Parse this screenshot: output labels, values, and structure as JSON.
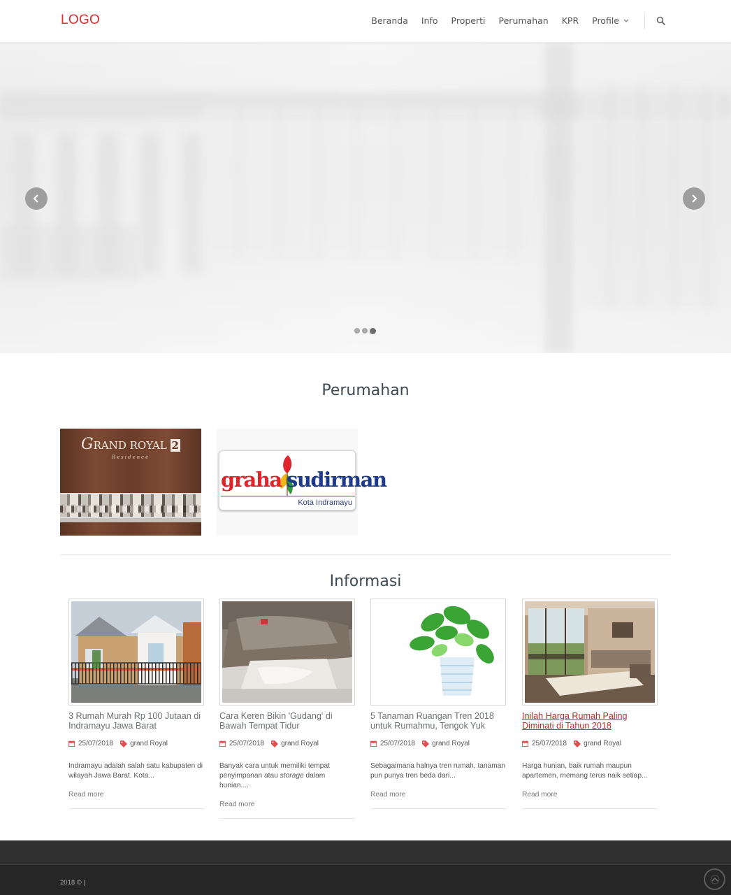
{
  "header": {
    "logo": "LOGO",
    "nav": [
      "Beranda",
      "Info",
      "Properti",
      "Perumahan",
      "KPR",
      "Profile"
    ]
  },
  "hero": {
    "slides": 3,
    "active_slide": 3
  },
  "perumahan": {
    "title": "Perumahan",
    "estates": [
      {
        "name_part1": "RAND ROYAL",
        "name_initial": "G",
        "name_number": "2",
        "subtitle": "Residence"
      },
      {
        "name_part1": "graha",
        "name_part2": "sudirman",
        "subtitle": "Kota Indramayu"
      }
    ]
  },
  "informasi": {
    "title": "Informasi",
    "articles": [
      {
        "title": "3 Rumah Murah Rp 100 Jutaan di Indramayu Jawa Barat",
        "date": "25/07/2018",
        "tag": "grand Royal",
        "excerpt": "Indramayu adalah salah satu kabupaten di wilayah Jawa Barat. Kota...",
        "read_more": "Read more"
      },
      {
        "title": "Cara Keren Bikin 'Gudang' di Bawah Tempat Tidur",
        "date": "25/07/2018",
        "tag": "grand Royal",
        "excerpt_pre": "Banyak cara untuk memiliki tempat penyimpanan atau ",
        "excerpt_em": "storage",
        "excerpt_post": " dalam hunian....",
        "read_more": "Read more"
      },
      {
        "title": "5 Tanaman Ruangan Tren 2018 untuk Rumahmu, Tengok Yuk",
        "date": "25/07/2018",
        "tag": "grand Royal",
        "excerpt": "Sebagaimana halnya tren rumah, tanaman pun punya tren beda dari...",
        "read_more": "Read more"
      },
      {
        "title": "Inilah Harga Rumah Paling Diminati di Tahun 2018",
        "date": "25/07/2018",
        "tag": "grand Royal",
        "excerpt": "Harga hunian, baik rumah maupun apartemen, memang terus naik setiap...",
        "read_more": "Read more"
      }
    ]
  },
  "footer": {
    "copyright": "2018 © |"
  },
  "colors": {
    "accent": "#d32f2f",
    "footer_dark": "#262626",
    "footer_mid": "#303030"
  },
  "icons": [
    "search-icon",
    "chevron-left-icon",
    "chevron-right-icon",
    "chevron-down-icon",
    "calendar-icon",
    "tag-icon",
    "arrow-up-icon"
  ]
}
